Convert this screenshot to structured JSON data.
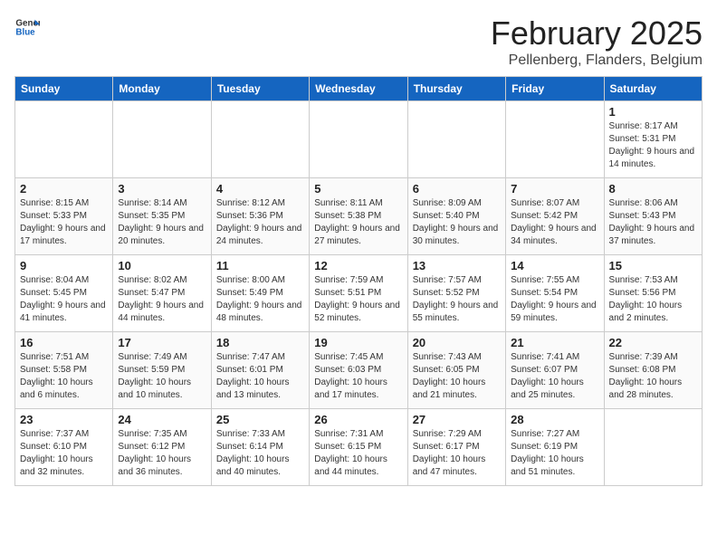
{
  "header": {
    "logo_line1": "General",
    "logo_line2": "Blue",
    "month_year": "February 2025",
    "location": "Pellenberg, Flanders, Belgium"
  },
  "days_of_week": [
    "Sunday",
    "Monday",
    "Tuesday",
    "Wednesday",
    "Thursday",
    "Friday",
    "Saturday"
  ],
  "weeks": [
    [
      {
        "day": "",
        "info": ""
      },
      {
        "day": "",
        "info": ""
      },
      {
        "day": "",
        "info": ""
      },
      {
        "day": "",
        "info": ""
      },
      {
        "day": "",
        "info": ""
      },
      {
        "day": "",
        "info": ""
      },
      {
        "day": "1",
        "info": "Sunrise: 8:17 AM\nSunset: 5:31 PM\nDaylight: 9 hours and 14 minutes."
      }
    ],
    [
      {
        "day": "2",
        "info": "Sunrise: 8:15 AM\nSunset: 5:33 PM\nDaylight: 9 hours and 17 minutes."
      },
      {
        "day": "3",
        "info": "Sunrise: 8:14 AM\nSunset: 5:35 PM\nDaylight: 9 hours and 20 minutes."
      },
      {
        "day": "4",
        "info": "Sunrise: 8:12 AM\nSunset: 5:36 PM\nDaylight: 9 hours and 24 minutes."
      },
      {
        "day": "5",
        "info": "Sunrise: 8:11 AM\nSunset: 5:38 PM\nDaylight: 9 hours and 27 minutes."
      },
      {
        "day": "6",
        "info": "Sunrise: 8:09 AM\nSunset: 5:40 PM\nDaylight: 9 hours and 30 minutes."
      },
      {
        "day": "7",
        "info": "Sunrise: 8:07 AM\nSunset: 5:42 PM\nDaylight: 9 hours and 34 minutes."
      },
      {
        "day": "8",
        "info": "Sunrise: 8:06 AM\nSunset: 5:43 PM\nDaylight: 9 hours and 37 minutes."
      }
    ],
    [
      {
        "day": "9",
        "info": "Sunrise: 8:04 AM\nSunset: 5:45 PM\nDaylight: 9 hours and 41 minutes."
      },
      {
        "day": "10",
        "info": "Sunrise: 8:02 AM\nSunset: 5:47 PM\nDaylight: 9 hours and 44 minutes."
      },
      {
        "day": "11",
        "info": "Sunrise: 8:00 AM\nSunset: 5:49 PM\nDaylight: 9 hours and 48 minutes."
      },
      {
        "day": "12",
        "info": "Sunrise: 7:59 AM\nSunset: 5:51 PM\nDaylight: 9 hours and 52 minutes."
      },
      {
        "day": "13",
        "info": "Sunrise: 7:57 AM\nSunset: 5:52 PM\nDaylight: 9 hours and 55 minutes."
      },
      {
        "day": "14",
        "info": "Sunrise: 7:55 AM\nSunset: 5:54 PM\nDaylight: 9 hours and 59 minutes."
      },
      {
        "day": "15",
        "info": "Sunrise: 7:53 AM\nSunset: 5:56 PM\nDaylight: 10 hours and 2 minutes."
      }
    ],
    [
      {
        "day": "16",
        "info": "Sunrise: 7:51 AM\nSunset: 5:58 PM\nDaylight: 10 hours and 6 minutes."
      },
      {
        "day": "17",
        "info": "Sunrise: 7:49 AM\nSunset: 5:59 PM\nDaylight: 10 hours and 10 minutes."
      },
      {
        "day": "18",
        "info": "Sunrise: 7:47 AM\nSunset: 6:01 PM\nDaylight: 10 hours and 13 minutes."
      },
      {
        "day": "19",
        "info": "Sunrise: 7:45 AM\nSunset: 6:03 PM\nDaylight: 10 hours and 17 minutes."
      },
      {
        "day": "20",
        "info": "Sunrise: 7:43 AM\nSunset: 6:05 PM\nDaylight: 10 hours and 21 minutes."
      },
      {
        "day": "21",
        "info": "Sunrise: 7:41 AM\nSunset: 6:07 PM\nDaylight: 10 hours and 25 minutes."
      },
      {
        "day": "22",
        "info": "Sunrise: 7:39 AM\nSunset: 6:08 PM\nDaylight: 10 hours and 28 minutes."
      }
    ],
    [
      {
        "day": "23",
        "info": "Sunrise: 7:37 AM\nSunset: 6:10 PM\nDaylight: 10 hours and 32 minutes."
      },
      {
        "day": "24",
        "info": "Sunrise: 7:35 AM\nSunset: 6:12 PM\nDaylight: 10 hours and 36 minutes."
      },
      {
        "day": "25",
        "info": "Sunrise: 7:33 AM\nSunset: 6:14 PM\nDaylight: 10 hours and 40 minutes."
      },
      {
        "day": "26",
        "info": "Sunrise: 7:31 AM\nSunset: 6:15 PM\nDaylight: 10 hours and 44 minutes."
      },
      {
        "day": "27",
        "info": "Sunrise: 7:29 AM\nSunset: 6:17 PM\nDaylight: 10 hours and 47 minutes."
      },
      {
        "day": "28",
        "info": "Sunrise: 7:27 AM\nSunset: 6:19 PM\nDaylight: 10 hours and 51 minutes."
      },
      {
        "day": "",
        "info": ""
      }
    ]
  ]
}
